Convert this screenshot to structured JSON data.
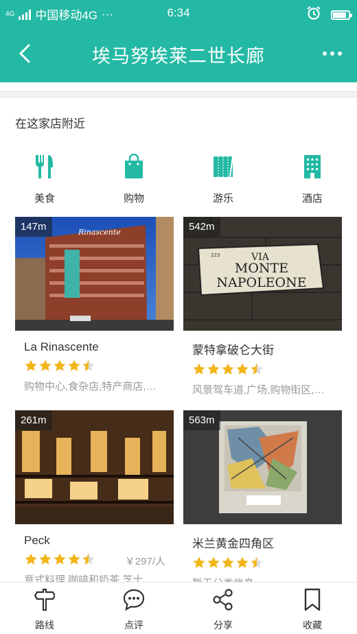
{
  "status": {
    "carrier": "中国移动4G",
    "more": "···",
    "time": "6:34",
    "net": "4G"
  },
  "nav": {
    "title": "埃马努埃莱二世长廊"
  },
  "section": {
    "title": "在这家店附近"
  },
  "categories": [
    {
      "label": "美食",
      "icon": "fork-knife-icon"
    },
    {
      "label": "购物",
      "icon": "shopping-bag-icon"
    },
    {
      "label": "游乐",
      "icon": "ticket-icon"
    },
    {
      "label": "酒店",
      "icon": "hotel-building-icon"
    }
  ],
  "places": [
    {
      "distance": "147m",
      "name": "La Rinascente",
      "rating": 4.5,
      "price": "",
      "tags": "购物中心,食杂店,特产商店,…"
    },
    {
      "distance": "542m",
      "name": "蒙特拿破仑大街",
      "rating": 4.5,
      "price": "",
      "tags": "风景驾车道,广场,购物街区,…",
      "sign_line1": "VIA",
      "sign_line2": "MONTE",
      "sign_line3": "NAPOLEONE",
      "sign_small": "223"
    },
    {
      "distance": "261m",
      "name": "Peck",
      "rating": 4.5,
      "price": "￥297/人",
      "tags": "意式料理,咖啡和奶茶,芝士…"
    },
    {
      "distance": "563m",
      "name": "米兰黄金四角区",
      "rating": 4.5,
      "price": "",
      "tags": "暂无分类信息"
    }
  ],
  "tabs": [
    {
      "label": "路线",
      "icon": "signpost-icon"
    },
    {
      "label": "点评",
      "icon": "comment-bubble-icon"
    },
    {
      "label": "分享",
      "icon": "share-icon"
    },
    {
      "label": "收藏",
      "icon": "bookmark-icon"
    }
  ],
  "colors": {
    "brand": "#23b9a4",
    "star": "#f2b51a",
    "star_empty": "#dcdcdc"
  }
}
